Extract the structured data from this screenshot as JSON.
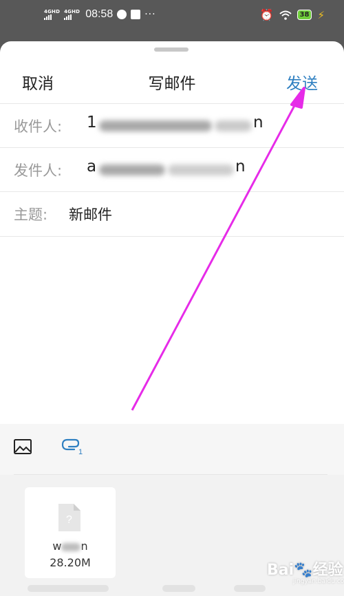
{
  "status_bar": {
    "signal1": "4GHD",
    "signal2": "4GHD",
    "time": "08:58",
    "battery": "38"
  },
  "header": {
    "cancel_label": "取消",
    "title": "写邮件",
    "send_label": "发送",
    "send_color": "#2e7fc1"
  },
  "form": {
    "to_label": "收件人:",
    "to_value": "1",
    "to_value_tail": "n",
    "from_label": "发件人:",
    "from_value": "a",
    "from_value_tail": "n",
    "subject_label": "主题:",
    "subject_value": "新邮件"
  },
  "toolbar": {
    "image_icon": "image-icon",
    "attach_icon": "attachment-icon"
  },
  "attachment": {
    "name": "w",
    "name_tail": "n",
    "size": "28.20M",
    "icon": "unknown-file-icon"
  },
  "annotation": {
    "arrow_color": "#e62be8"
  },
  "watermark": {
    "text": "Bai",
    "suffix": "经验",
    "sub": "jingyan.baidu.com"
  }
}
